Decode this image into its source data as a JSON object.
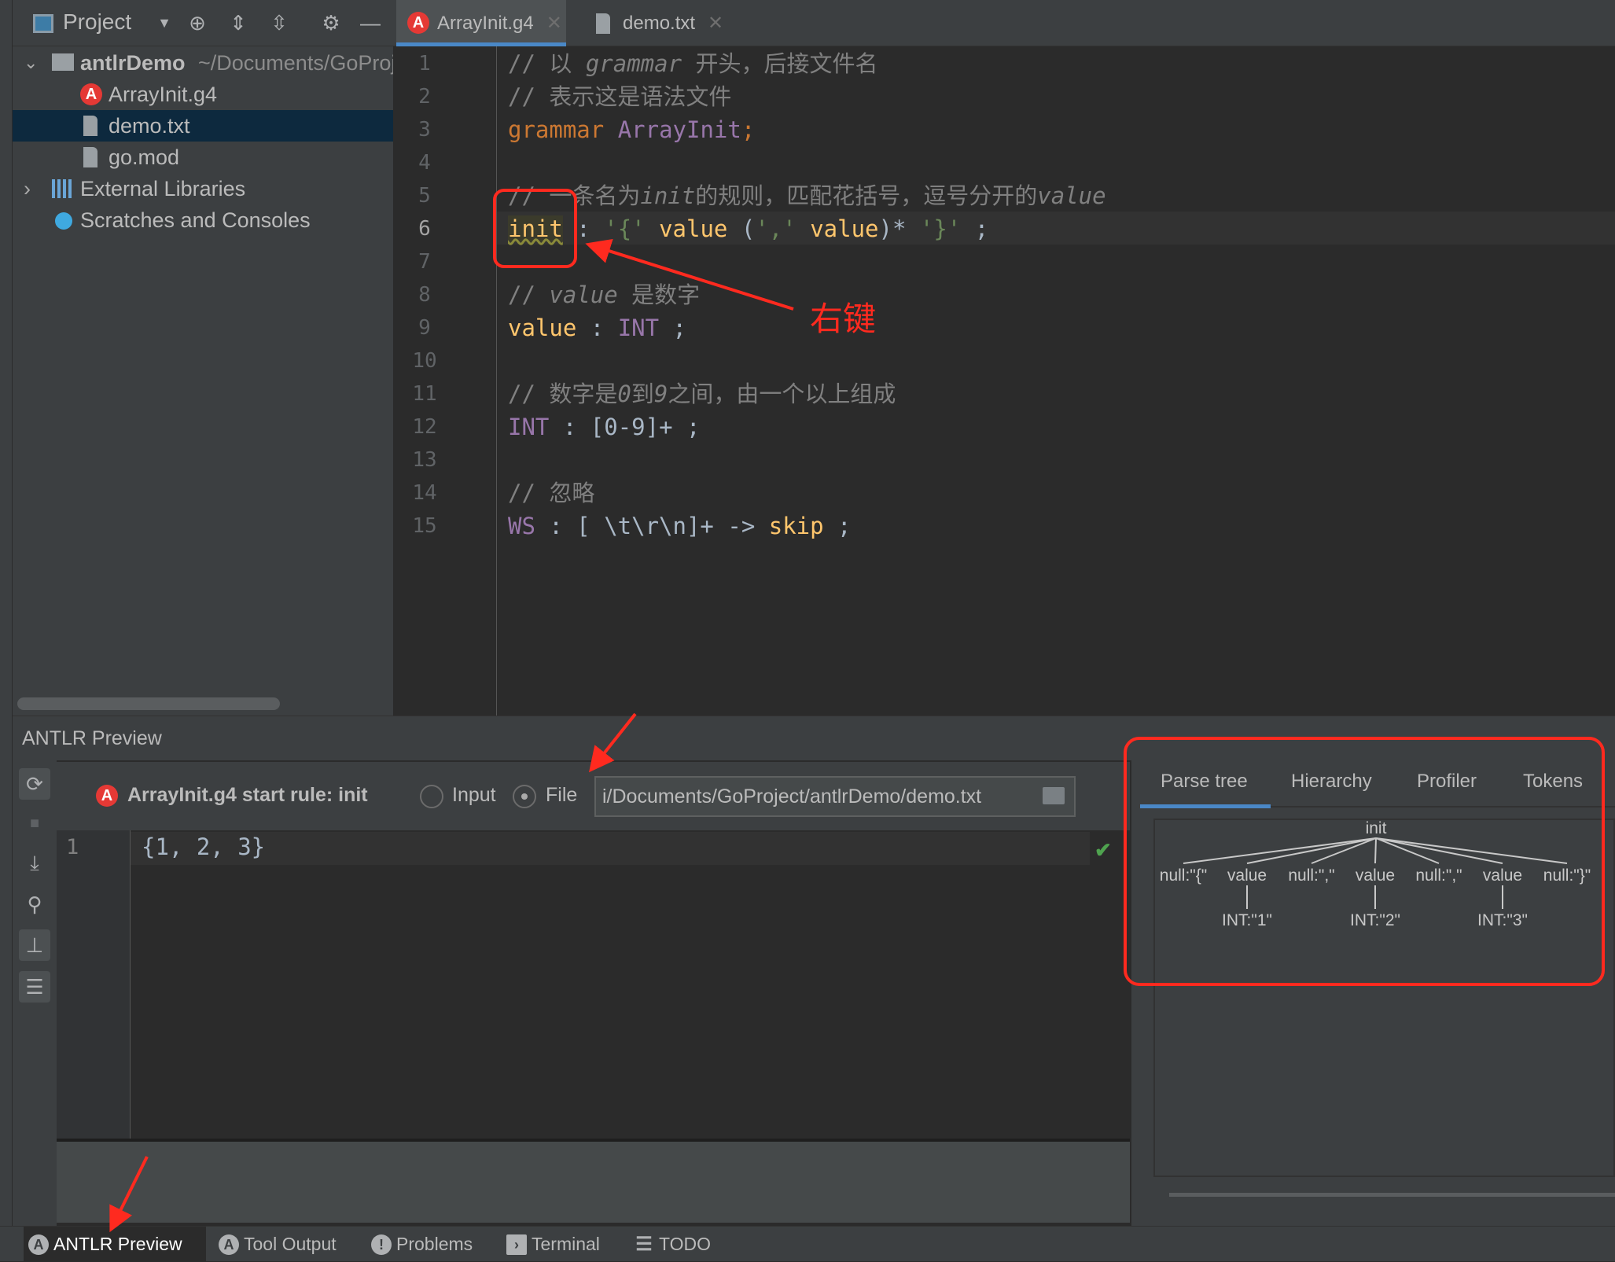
{
  "project_panel": {
    "title": "Project",
    "tree": [
      {
        "label": "antlrDemo",
        "path": "~/Documents/GoProject/antlrDemo",
        "icon": "folder-icon"
      },
      {
        "label": "ArrayInit.g4",
        "icon": "antlr-icon"
      },
      {
        "label": "demo.txt",
        "icon": "text-file-icon",
        "selected": true
      },
      {
        "label": "go.mod",
        "icon": "text-file-icon"
      },
      {
        "label": "External Libraries",
        "icon": "library-icon"
      },
      {
        "label": "Scratches and Consoles",
        "icon": "scratches-icon"
      }
    ]
  },
  "editor_tabs": [
    {
      "label": "ArrayInit.g4",
      "active": true
    },
    {
      "label": "demo.txt",
      "active": false
    }
  ],
  "editor": {
    "line_numbers": [
      "1",
      "2",
      "3",
      "4",
      "5",
      "6",
      "7",
      "8",
      "9",
      "10",
      "11",
      "12",
      "13",
      "14",
      "15"
    ],
    "lines": [
      [
        {
          "t": "// 以 ",
          "c": "comment"
        },
        {
          "t": "grammar",
          "c": "ci"
        },
        {
          "t": " 开头，后接文件名",
          "c": "comment"
        }
      ],
      [
        {
          "t": "// 表示这是语法文件",
          "c": "comment"
        }
      ],
      [
        {
          "t": "grammar",
          "c": "kw"
        },
        {
          "t": " ",
          "c": "plain"
        },
        {
          "t": "ArrayInit",
          "c": "cls"
        },
        {
          "t": ";",
          "c": "kw"
        }
      ],
      [],
      [
        {
          "t": "// 一条名为",
          "c": "comment"
        },
        {
          "t": "init",
          "c": "ci"
        },
        {
          "t": "的规则，匹配花括号，逗号分开的",
          "c": "comment"
        },
        {
          "t": "value",
          "c": "ci"
        }
      ],
      [
        {
          "t": "init",
          "c": "rule"
        },
        {
          "t": " : ",
          "c": "plain"
        },
        {
          "t": "'{'",
          "c": "str"
        },
        {
          "t": " ",
          "c": "plain"
        },
        {
          "t": "value",
          "c": "rule"
        },
        {
          "t": " (",
          "c": "plain"
        },
        {
          "t": "','",
          "c": "str"
        },
        {
          "t": " ",
          "c": "plain"
        },
        {
          "t": "value",
          "c": "rule"
        },
        {
          "t": ")* ",
          "c": "plain"
        },
        {
          "t": "'}'",
          "c": "str"
        },
        {
          "t": " ;",
          "c": "plain"
        }
      ],
      [],
      [
        {
          "t": "// ",
          "c": "comment"
        },
        {
          "t": "value",
          "c": "ci"
        },
        {
          "t": " 是数字",
          "c": "comment"
        }
      ],
      [
        {
          "t": "value",
          "c": "rule"
        },
        {
          "t": " : ",
          "c": "plain"
        },
        {
          "t": "INT",
          "c": "cls"
        },
        {
          "t": " ;",
          "c": "plain"
        }
      ],
      [],
      [
        {
          "t": "// 数字是",
          "c": "comment"
        },
        {
          "t": "0",
          "c": "ci"
        },
        {
          "t": "到",
          "c": "comment"
        },
        {
          "t": "9",
          "c": "ci"
        },
        {
          "t": "之间，由一个以上组成",
          "c": "comment"
        }
      ],
      [
        {
          "t": "INT",
          "c": "cls"
        },
        {
          "t": " : [0-9]+ ;",
          "c": "plain"
        }
      ],
      [],
      [
        {
          "t": "// 忽略",
          "c": "comment"
        }
      ],
      [
        {
          "t": "WS",
          "c": "cls"
        },
        {
          "t": " : [ \\t\\r\\n]+ -> ",
          "c": "plain"
        },
        {
          "t": "skip",
          "c": "skip"
        },
        {
          "t": " ;",
          "c": "plain"
        }
      ]
    ]
  },
  "annotation": {
    "label": "右键",
    "color": "#ff2a1f"
  },
  "bottom_panel": {
    "title": "ANTLR Preview",
    "grammar_label": "ArrayInit.g4 start rule: init",
    "radio_input": "Input",
    "radio_file": "File",
    "selected_source": "File",
    "file_path": "i/Documents/GoProject/antlrDemo/demo.txt",
    "input_line_number": "1",
    "input_text": "{1, 2, 3}",
    "status_icon": "checkmark-icon"
  },
  "right_tabs": [
    {
      "label": "Parse tree",
      "active": true
    },
    {
      "label": "Hierarchy"
    },
    {
      "label": "Profiler"
    },
    {
      "label": "Tokens"
    }
  ],
  "parse_tree": {
    "root": "init",
    "children": [
      {
        "label": "null:\"{\""
      },
      {
        "label": "value",
        "child": "INT:\"1\""
      },
      {
        "label": "null:\",\""
      },
      {
        "label": "value",
        "child": "INT:\"2\""
      },
      {
        "label": "null:\",\""
      },
      {
        "label": "value",
        "child": "INT:\"3\""
      },
      {
        "label": "null:\"}\""
      }
    ]
  },
  "status_bar": [
    {
      "label": "ANTLR Preview",
      "active": true,
      "icon": "antlr-icon"
    },
    {
      "label": "Tool Output",
      "icon": "antlr-icon"
    },
    {
      "label": "Problems",
      "icon": "problems-icon"
    },
    {
      "label": "Terminal",
      "icon": "terminal-icon"
    },
    {
      "label": "TODO",
      "icon": "todo-icon"
    }
  ]
}
